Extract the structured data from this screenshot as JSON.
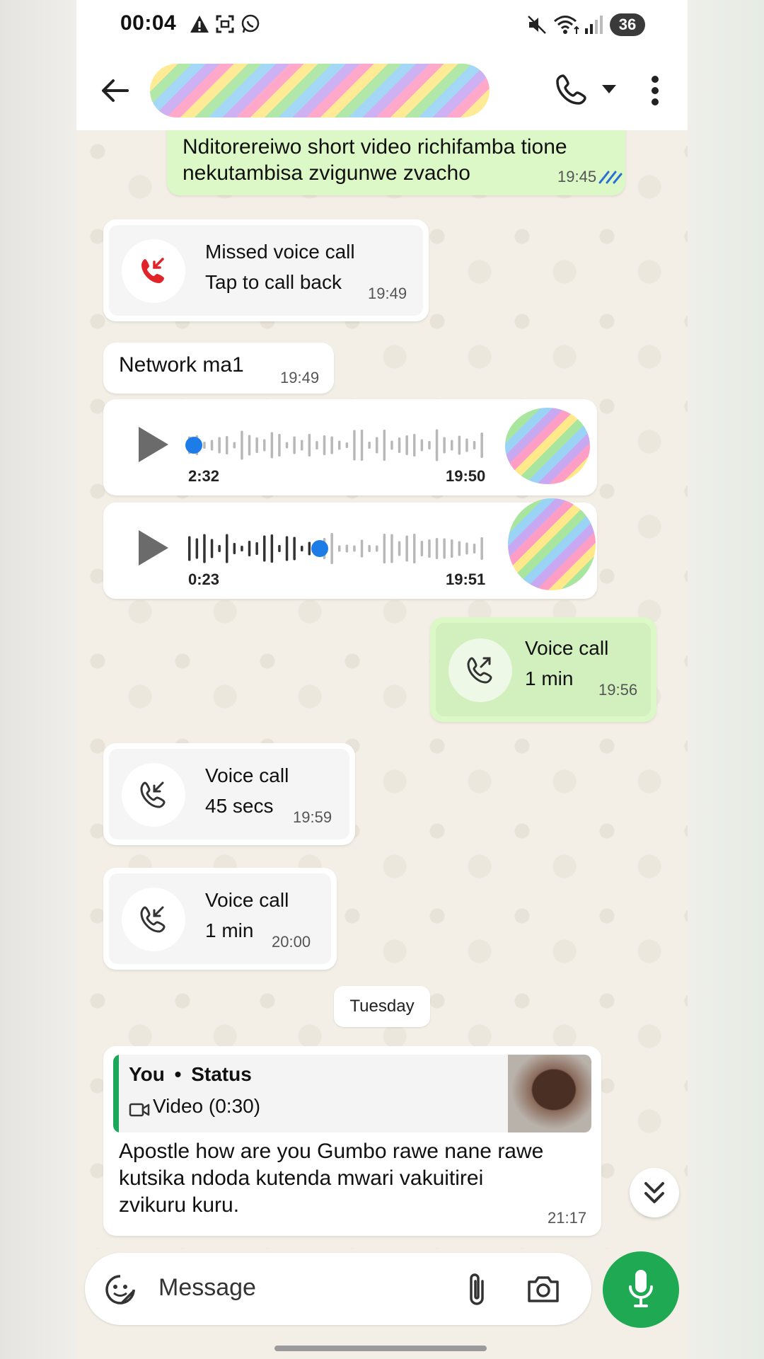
{
  "status_bar": {
    "time": "00:04",
    "battery": "36"
  },
  "header": {
    "back_label": "Back",
    "contact_name_redacted": true
  },
  "messages": {
    "m1": {
      "text_line1": "Nditorereiwo short video richifamba tione",
      "text_line2": "nekutambisa zvigunwe zvacho",
      "time": "19:45"
    },
    "missed_call": {
      "title": "Missed voice call",
      "subtitle": "Tap to call back",
      "time": "19:49"
    },
    "m2": {
      "text": "Network ma1",
      "time": "19:49"
    },
    "voice1": {
      "duration": "2:32",
      "time": "19:50",
      "progress": 0.0
    },
    "voice2": {
      "duration": "0:23",
      "time": "19:51",
      "progress": 0.42
    },
    "out_call": {
      "title": "Voice call",
      "subtitle": "1 min",
      "time": "19:56"
    },
    "in_call1": {
      "title": "Voice call",
      "subtitle": "45 secs",
      "time": "19:59"
    },
    "in_call2": {
      "title": "Voice call",
      "subtitle": "1 min",
      "time": "20:00"
    },
    "day_separator": "Tuesday",
    "reply": {
      "quote_author": "You",
      "quote_sep": "•",
      "quote_source": "Status",
      "quote_media": "Video (0:30)",
      "text_line1": "Apostle how are you Gumbo rawe nane rawe",
      "text_line2": "kutsika ndoda kutenda mwari vakuitirei",
      "text_line3": "zvikuru kuru.",
      "time": "21:17"
    }
  },
  "composer": {
    "placeholder": "Message"
  },
  "icons": {
    "back": "arrow-left-icon",
    "call": "phone-icon",
    "menu": "more-vert-icon",
    "emoji": "sticker-icon",
    "attach": "paperclip-icon",
    "camera": "camera-icon",
    "mic": "mic-icon"
  },
  "colors": {
    "outgoing_bubble": "#dcf8c6",
    "accent_green": "#1ea952",
    "read_ticks": "#2a6fd6",
    "missed_red": "#e0242a"
  }
}
